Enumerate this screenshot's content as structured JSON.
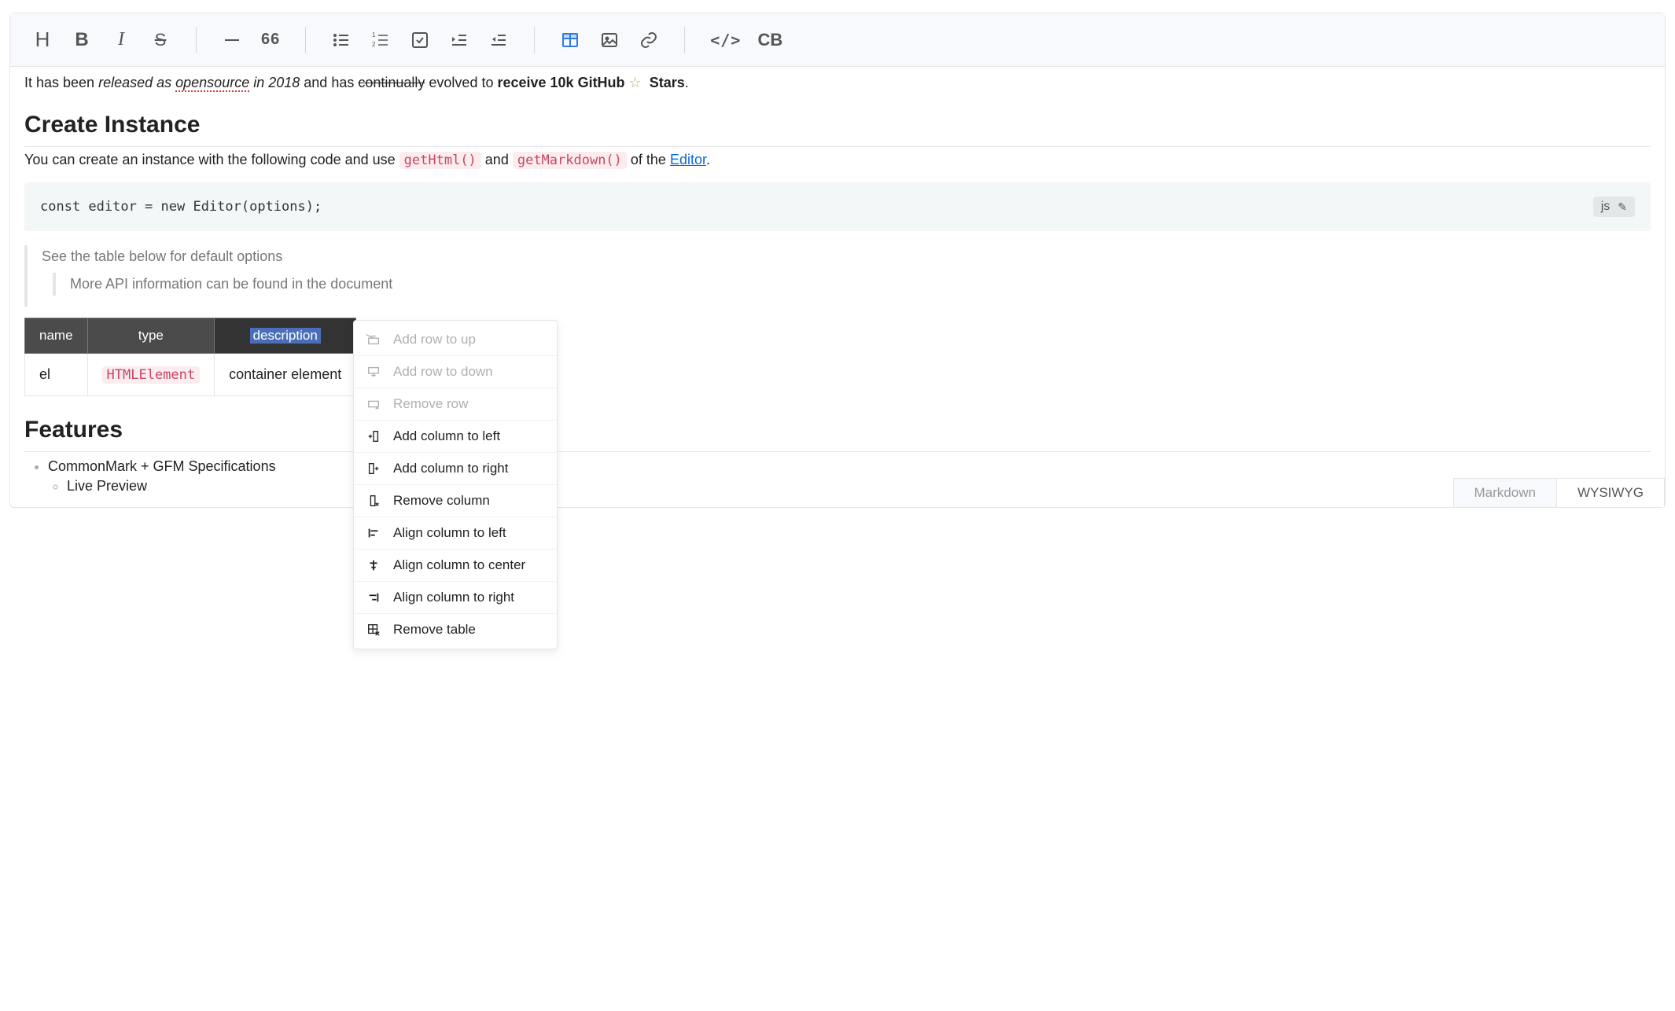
{
  "toolbar": {
    "heading": "H",
    "quote_digits": "66",
    "code_label": "</>",
    "codeblock_label": "CB"
  },
  "content": {
    "p1_a": "It has been ",
    "p1_b": "released as ",
    "p1_c": "opensource",
    "p1_d": " in 2018",
    "p1_e": " and has ",
    "p1_f": "continually",
    "p1_g": " evolved to ",
    "p1_h": "receive 10k GitHub",
    "p1_i": "Stars",
    "p1_dot": ".",
    "h_create": "Create Instance",
    "p2_a": "You can create an instance with the following code and use ",
    "p2_code1": "getHtml()",
    "p2_b": " and ",
    "p2_code2": "getMarkdown()",
    "p2_c": " of the ",
    "p2_link": "Editor",
    "p2_d": ".",
    "code_line": "const editor = new Editor(options);",
    "code_lang": "js",
    "bq1": "See the table below for default options",
    "bq2": "More API information can be found in the document",
    "h_features": "Features",
    "feat1": "CommonMark + GFM Specifications",
    "feat1_sub1": "Live Preview"
  },
  "table": {
    "headers": [
      "name",
      "type",
      "description"
    ],
    "row1": {
      "name": "el",
      "type": "HTMLElement",
      "desc": "container element"
    }
  },
  "context_menu": {
    "items": [
      {
        "label": "Add row to up",
        "disabled": true,
        "icon": "row-up"
      },
      {
        "label": "Add row to down",
        "disabled": true,
        "icon": "row-down"
      },
      {
        "label": "Remove row",
        "disabled": true,
        "icon": "row-del"
      },
      {
        "label": "Add column to left",
        "disabled": false,
        "icon": "col-left"
      },
      {
        "label": "Add column to right",
        "disabled": false,
        "icon": "col-right"
      },
      {
        "label": "Remove column",
        "disabled": false,
        "icon": "col-del"
      },
      {
        "label": "Align column to left",
        "disabled": false,
        "icon": "align-left"
      },
      {
        "label": "Align column to center",
        "disabled": false,
        "icon": "align-center"
      },
      {
        "label": "Align column to right",
        "disabled": false,
        "icon": "align-right"
      },
      {
        "label": "Remove table",
        "disabled": false,
        "icon": "table-del"
      }
    ]
  },
  "mode": {
    "markdown": "Markdown",
    "wysiwyg": "WYSIWYG"
  }
}
